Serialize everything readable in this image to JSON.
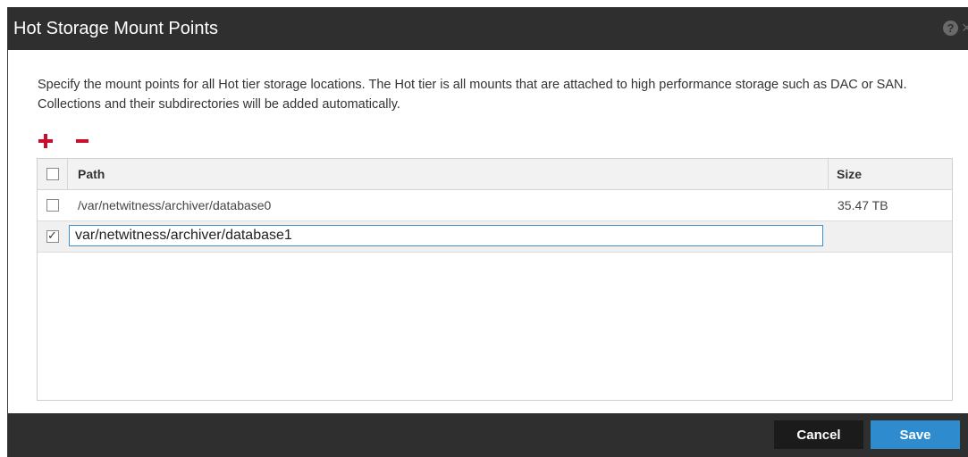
{
  "dialog": {
    "title": "Hot Storage Mount Points",
    "help_icon": "help-icon",
    "close_icon": "close-icon",
    "description": "Specify the mount points for all Hot tier storage locations. The Hot tier is all mounts that are attached to high performance storage such as DAC or SAN. Collections and their subdirectories will be added automatically."
  },
  "toolbar": {
    "add_icon": "plus-icon",
    "remove_icon": "minus-icon"
  },
  "table": {
    "columns": [
      "Path",
      "Size"
    ],
    "select_all_checked": false,
    "rows": [
      {
        "checked": false,
        "path": "/var/netwitness/archiver/database0",
        "size": "35.47 TB"
      },
      {
        "checked": true,
        "path": "var/netwitness/archiver/database1",
        "size": ""
      }
    ]
  },
  "footer": {
    "cancel_label": "Cancel",
    "save_label": "Save"
  },
  "colors": {
    "titlebar": "#2f2f2f",
    "accent": "#2d8bce",
    "icon_red": "#c8102e"
  }
}
